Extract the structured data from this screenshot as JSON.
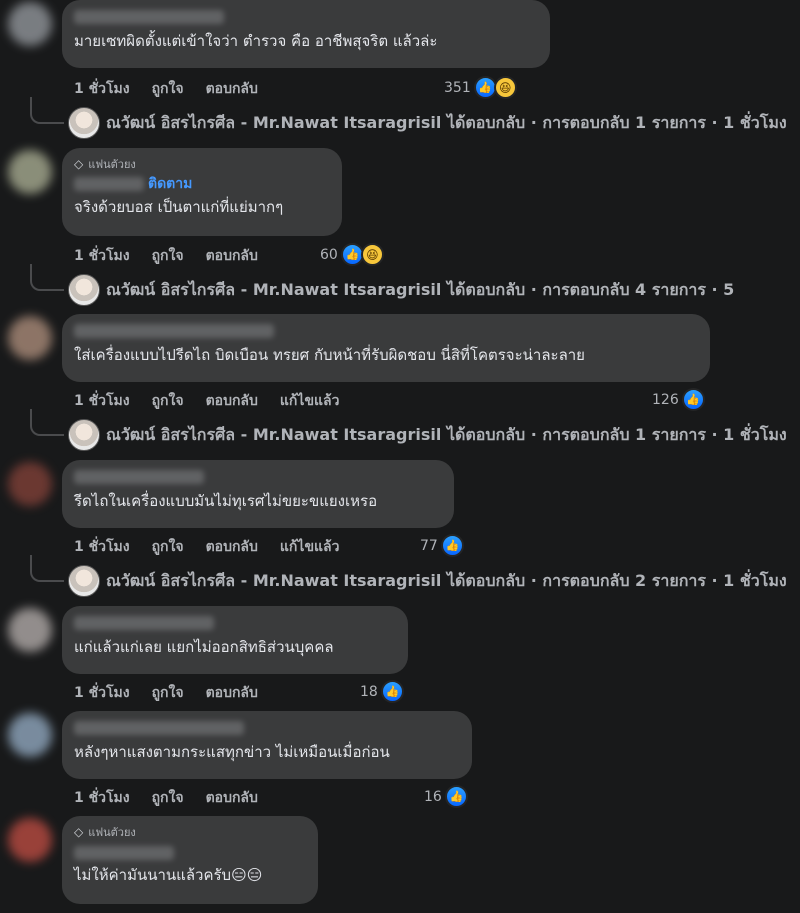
{
  "actions": {
    "time": "1 ชั่วโมง",
    "like": "ถูกใจ",
    "reply": "ตอบกลับ",
    "edited": "แก้ไขแล้ว"
  },
  "badge": {
    "fan_label": "แฟนตัวยง",
    "follow_label": "ติดตาม"
  },
  "reply_author": "ณวัฒน์ อิสรไกรศีล - Mr.Nawat Itsaragrisil",
  "comments": [
    {
      "text": "มายเซทผิดตั้งแต่เข้าใจว่า ตำรวจ คือ อาชีพสุจริต แล้วล่ะ",
      "reaction_count": "351",
      "reply_summary": "ได้ตอบกลับ · การตอบกลับ 1 รายการ · 1 ชั่วโมง"
    },
    {
      "text": "จริงด้วยบอส เป็นตาแก่ที่แย่มากๆ",
      "reaction_count": "60",
      "reply_summary": "ได้ตอบกลับ · การตอบกลับ 4 รายการ · 5"
    },
    {
      "text": "ใส่เครื่องแบบไปรีดไถ บิดเบือน ทรยศ กับหน้าที่รับผิดชอบ นี่สิที่โคตรจะน่าละลาย",
      "reaction_count": "126",
      "reply_summary": "ได้ตอบกลับ · การตอบกลับ 1 รายการ · 1 ชั่วโมง"
    },
    {
      "text": "รีดไถในเครื่องแบบมันไม่ทุเรศไม่ขยะขแยงเหรอ",
      "reaction_count": "77",
      "reply_summary": "ได้ตอบกลับ · การตอบกลับ 2 รายการ · 1 ชั่วโมง"
    },
    {
      "text": "แก่แล้วแก่เลย แยกไม่ออกสิทธิส่วนบุคคล",
      "reaction_count": "18"
    },
    {
      "text": "หลังๆหาแสงตามกระแสทุกข่าว ไม่เหมือนเมื่อก่อน",
      "reaction_count": "16"
    },
    {
      "text": "ไม่ให้ค่ามันนานแล้วครับ😑😑"
    }
  ],
  "colors": {
    "background": "#18191a",
    "bubble": "#3a3b3c",
    "like_blue": "#0866ff",
    "follow_blue": "#4599ff"
  },
  "icons": {
    "like": "thumbs-up-icon",
    "haha": "laughing-face-icon",
    "fan": "diamond-badge-icon"
  }
}
